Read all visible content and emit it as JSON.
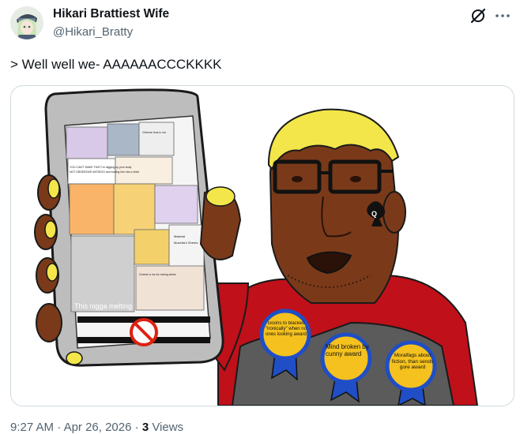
{
  "author": {
    "display_name": "Hikari Brattiest Wife",
    "handle": "@Hikari_Bratty",
    "avatar_icon": "anime-avatar"
  },
  "header_icons": [
    "grok-icon",
    "more-icon"
  ],
  "tweet": {
    "text": "> Well well we- AAAAAACCCKKKK"
  },
  "media": {
    "phone_caption": "This nigga melting",
    "phone_small_text": [
      "YOU CAN'T MAKE THAT I'm digging up your body",
      "NOT OBSESSIVE ANTIEGO and turning him into a drink",
      "Chinese thus is not",
      "Material",
      "Mozetia's Sheets",
      "Cheese a ms for mixing wines"
    ],
    "badges": [
      "Goons to blacked \"ironically\" when no ones looking award",
      "Mind broken by cunny award",
      "Moralfags about fiction, than sends gore award"
    ]
  },
  "meta": {
    "time": "9:27 AM",
    "separator": "·",
    "date": "Apr 26, 2026",
    "views_count": "3",
    "views_label": "Views"
  },
  "colors": {
    "text_primary": "#0f1419",
    "text_secondary": "#536471",
    "border": "#cfd9de",
    "shirt_red": "#c0101a",
    "skin_brown": "#7a3a1a",
    "hair_yellow": "#f3e64a",
    "badge_blue": "#1f4ec6",
    "badge_gold": "#f4c11e"
  }
}
